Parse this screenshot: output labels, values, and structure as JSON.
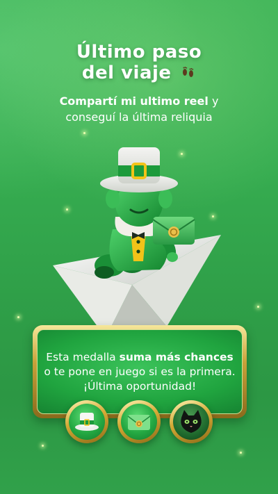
{
  "header": {
    "title_line1": "Último paso",
    "title_line2": "del viaje",
    "title_icon": "footprints-icon"
  },
  "subtitle": {
    "bold_text": "Compartí mi ultimo reel",
    "text_after_bold": " y",
    "line2": "conseguí la última reliquia"
  },
  "illustration": {
    "name": "leprechaun-on-paper-plane-illustration"
  },
  "panel": {
    "text_before": "Esta medalla ",
    "text_bold": "suma más chances",
    "text_after": "o te pone en juego si es la primera. ¡Última oportunidad!"
  },
  "medals": [
    {
      "icon": "leprechaun-hat-icon"
    },
    {
      "icon": "envelope-seal-icon"
    },
    {
      "icon": "black-cat-icon"
    }
  ],
  "colors": {
    "background": "#36ac50",
    "gold_frame": "#c9a23a",
    "panel_green": "#20a43f",
    "text": "#ffffff"
  }
}
